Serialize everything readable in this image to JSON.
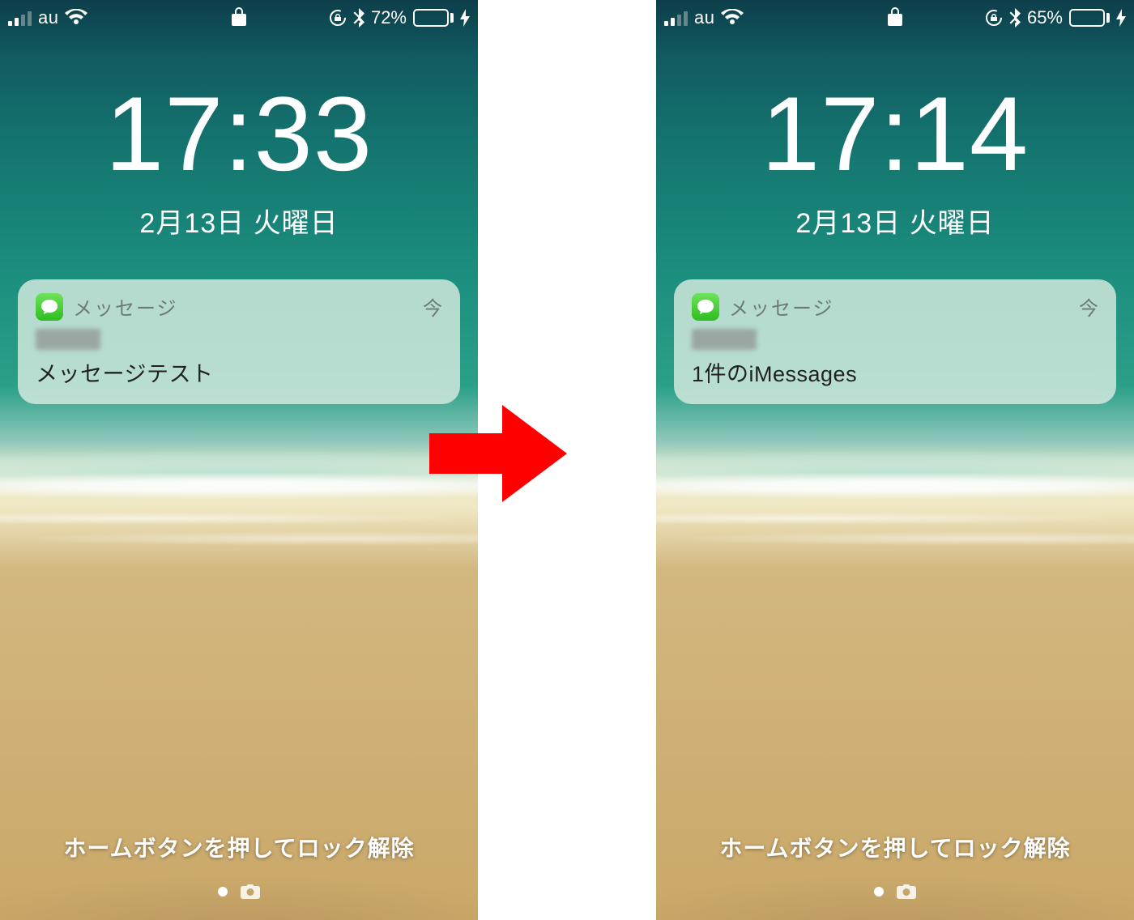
{
  "screens": [
    {
      "status": {
        "carrier": "au",
        "battery_pct": "72%",
        "battery_fill": 72
      },
      "clock": {
        "time": "17:33",
        "date": "2月13日 火曜日"
      },
      "notification": {
        "app": "メッセージ",
        "when": "今",
        "body": "メッセージテスト"
      },
      "unlock_hint": "ホームボタンを押してロック解除"
    },
    {
      "status": {
        "carrier": "au",
        "battery_pct": "65%",
        "battery_fill": 65
      },
      "clock": {
        "time": "17:14",
        "date": "2月13日 火曜日"
      },
      "notification": {
        "app": "メッセージ",
        "when": "今",
        "body": "1件のiMessages"
      },
      "unlock_hint": "ホームボタンを押してロック解除"
    }
  ]
}
